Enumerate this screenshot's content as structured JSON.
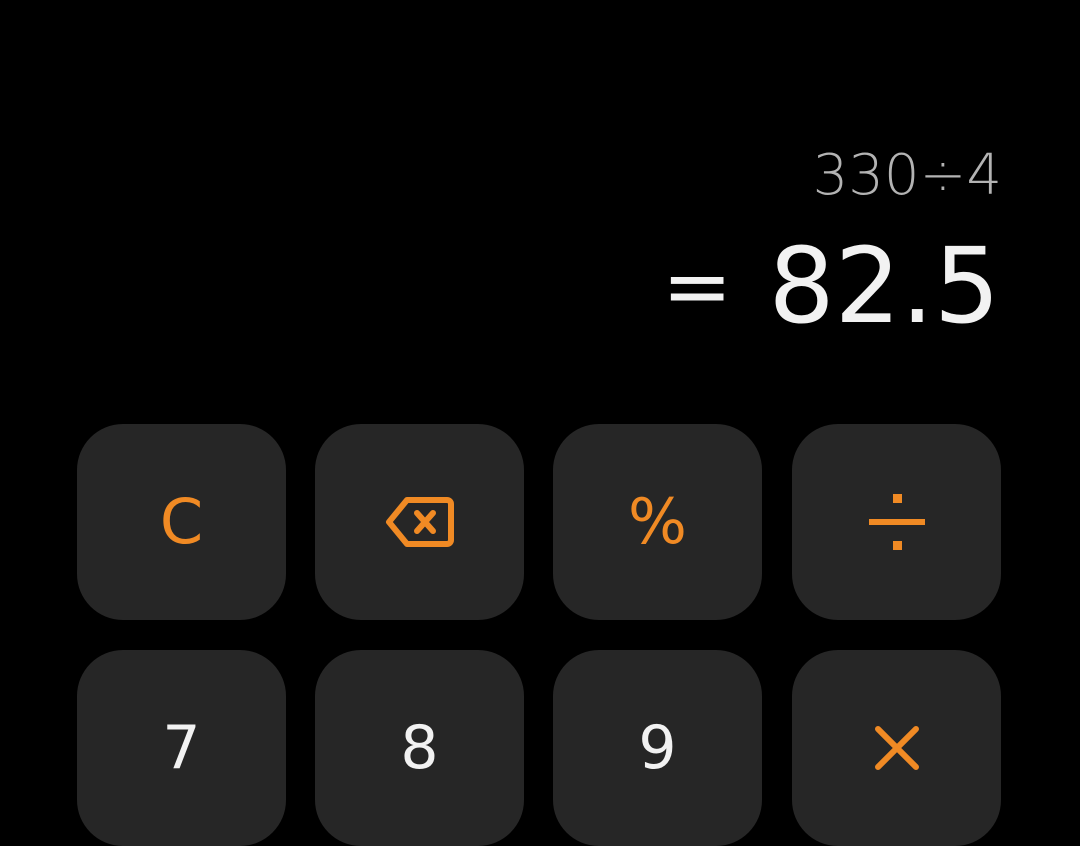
{
  "colors": {
    "background": "#000000",
    "key_background": "#262626",
    "accent": "#f08a24",
    "digit": "#f2f2f2",
    "expression": "#b3b3b3"
  },
  "display": {
    "expression": "330÷4",
    "result_prefix": "=",
    "result_value": "82.5"
  },
  "keys": {
    "clear": {
      "label": "C",
      "icon": null
    },
    "backspace": {
      "label": null,
      "icon": "backspace-icon"
    },
    "percent": {
      "label": "%",
      "icon": null
    },
    "divide": {
      "label": null,
      "icon": "divide-icon"
    },
    "seven": {
      "label": "7"
    },
    "eight": {
      "label": "8"
    },
    "nine": {
      "label": "9"
    },
    "multiply": {
      "label": "×",
      "icon": "multiply-icon"
    }
  }
}
